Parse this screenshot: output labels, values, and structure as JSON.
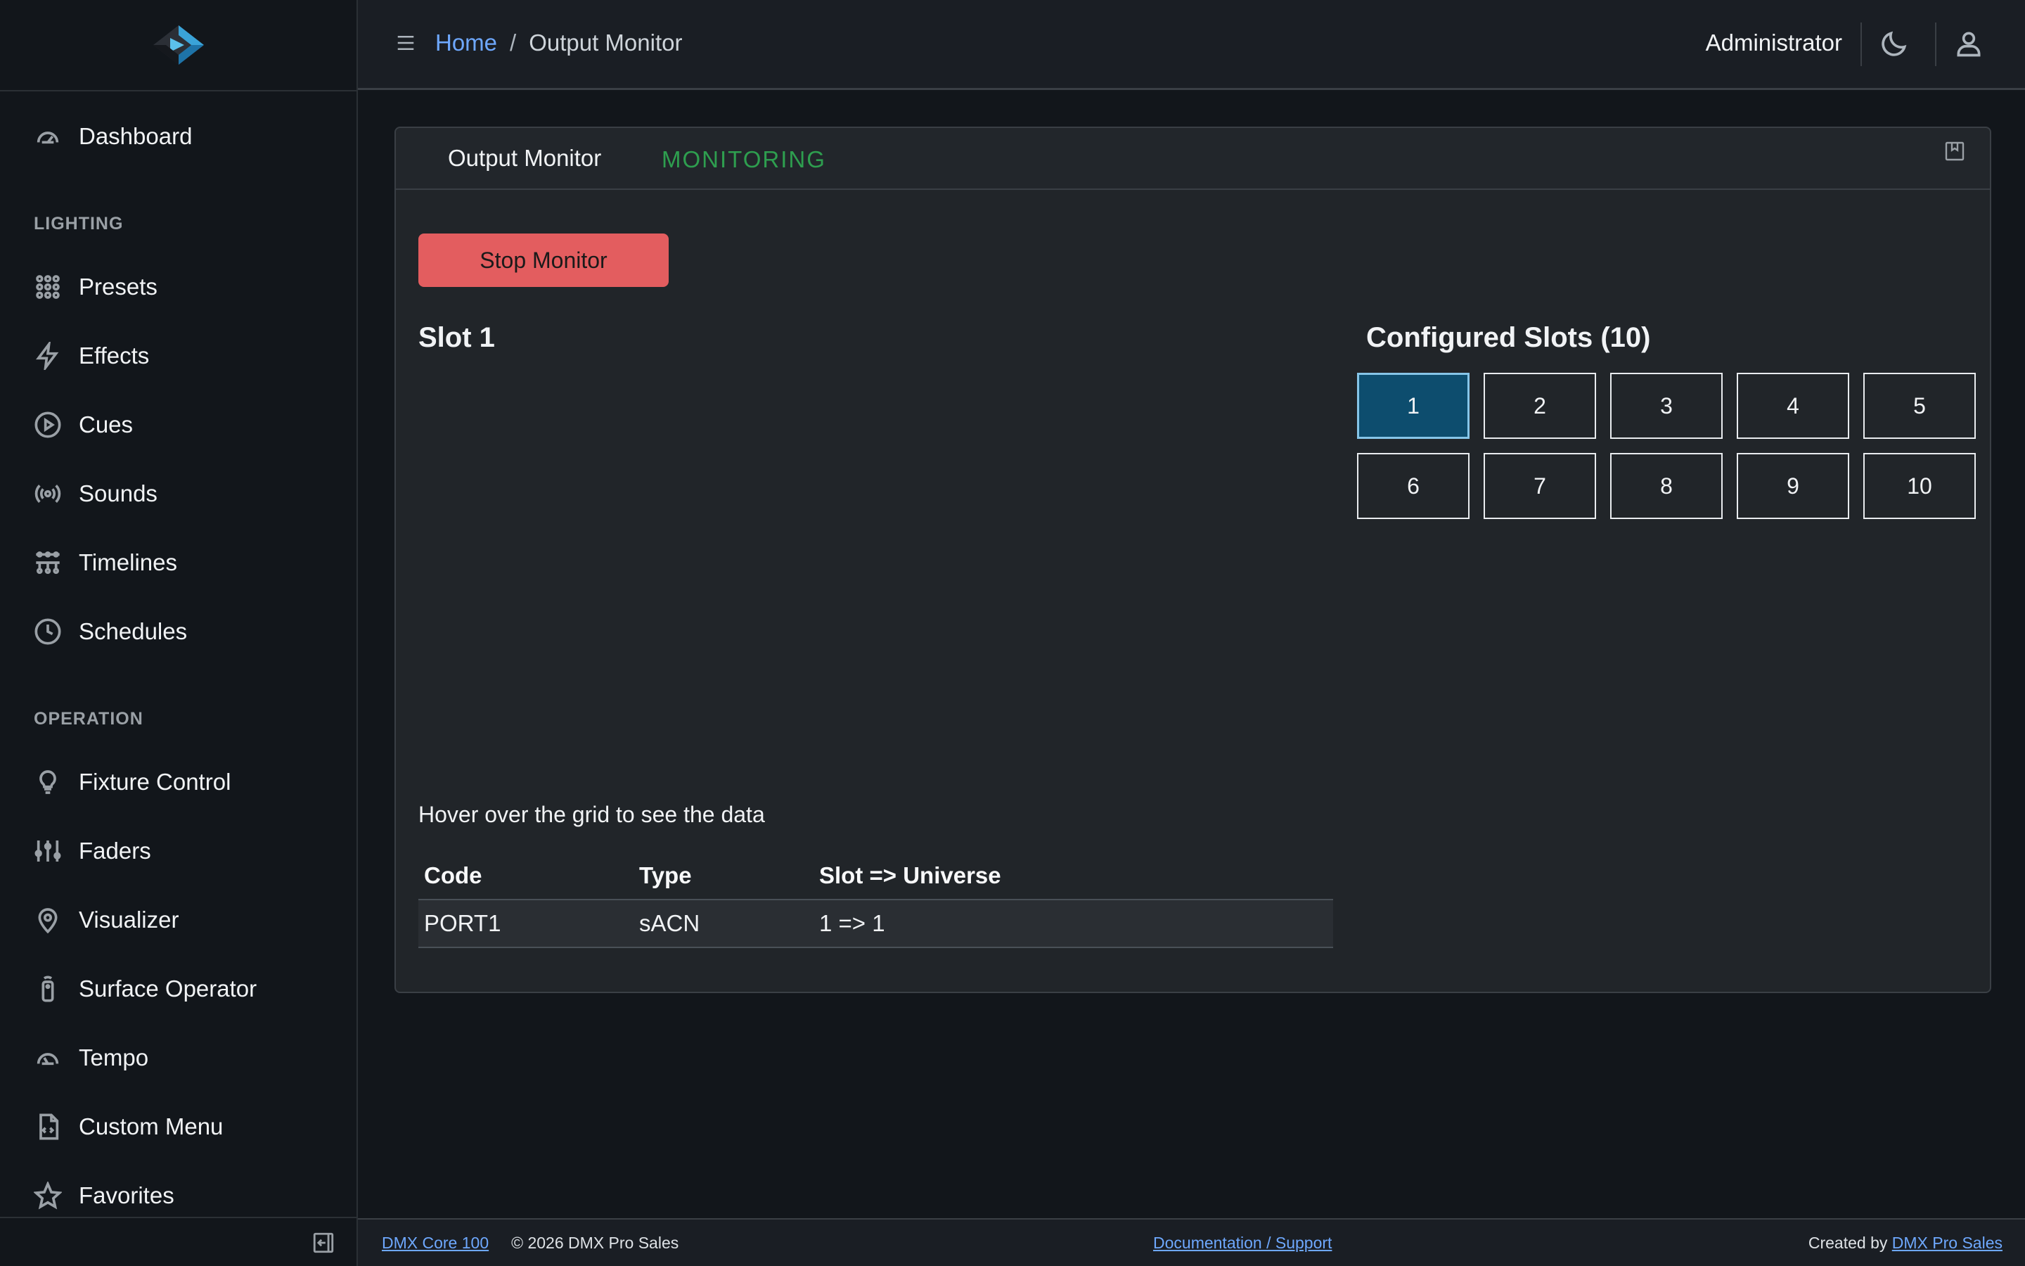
{
  "header": {
    "breadcrumb_home": "Home",
    "breadcrumb_sep": "/",
    "breadcrumb_current": "Output Monitor",
    "user_name": "Administrator"
  },
  "sidebar": {
    "dashboard": "Dashboard",
    "section_lighting": "LIGHTING",
    "lighting_items": [
      "Presets",
      "Effects",
      "Cues",
      "Sounds",
      "Timelines",
      "Schedules"
    ],
    "section_operation": "OPERATION",
    "operation_items": [
      "Fixture Control",
      "Faders",
      "Visualizer",
      "Surface Operator",
      "Tempo",
      "Custom Menu",
      "Favorites"
    ]
  },
  "card": {
    "tab_title": "Output Monitor",
    "status": "MONITORING",
    "stop_button": "Stop Monitor",
    "slot_title": "Slot 1",
    "configured_title": "Configured Slots (10)",
    "slots": [
      "1",
      "2",
      "3",
      "4",
      "5",
      "6",
      "7",
      "8",
      "9",
      "10"
    ],
    "active_slot": "1",
    "hover_hint": "Hover over the grid to see the data",
    "table": {
      "headers": [
        "Code",
        "Type",
        "Slot => Universe"
      ],
      "rows": [
        [
          "PORT1",
          "sACN",
          "1 => 1"
        ]
      ]
    }
  },
  "footer": {
    "product_link": "DMX Core 100",
    "copyright": "© 2026 DMX Pro Sales",
    "docs_link": "Documentation / Support",
    "created_by": "Created by",
    "created_link": "DMX Pro Sales"
  },
  "colors": {
    "accent_link": "#6ea8fe",
    "status_green": "#2e9e4f",
    "stop_red": "#e35d5f",
    "active_slot": "#0d4d6e"
  }
}
